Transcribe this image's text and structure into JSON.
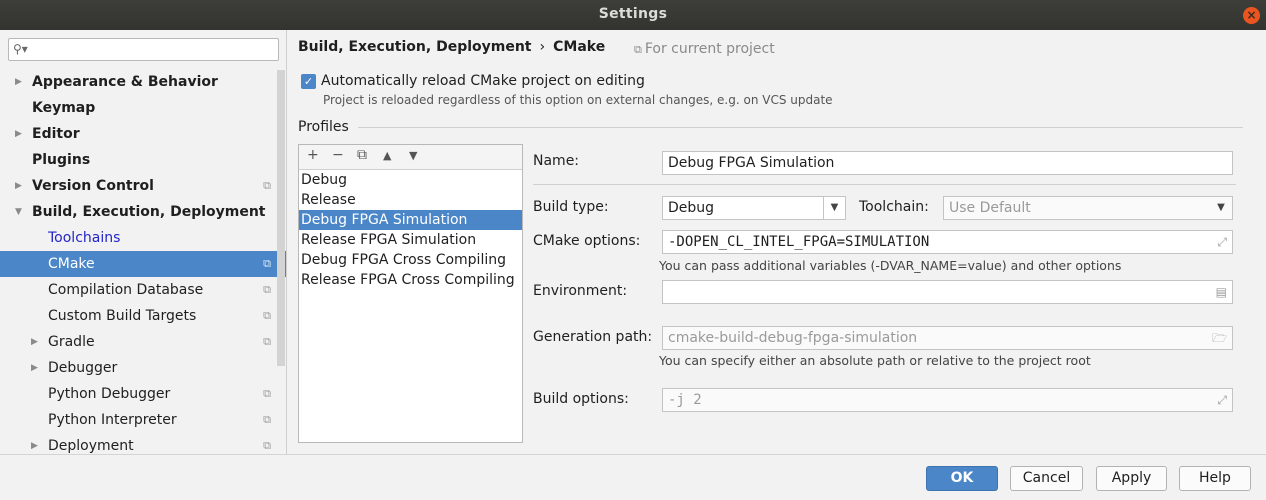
{
  "window": {
    "title": "Settings",
    "close_glyph": "×"
  },
  "sidebar": {
    "search_placeholder": "",
    "search_icon": "magnifier-icon",
    "items": [
      {
        "label": "Appearance & Behavior",
        "level": 0,
        "expandable": true,
        "expanded": false,
        "project_scoped": false
      },
      {
        "label": "Keymap",
        "level": 0,
        "expandable": false,
        "project_scoped": false
      },
      {
        "label": "Editor",
        "level": 0,
        "expandable": true,
        "expanded": false,
        "project_scoped": false
      },
      {
        "label": "Plugins",
        "level": 0,
        "expandable": false,
        "project_scoped": false
      },
      {
        "label": "Version Control",
        "level": 0,
        "expandable": true,
        "expanded": false,
        "project_scoped": true
      },
      {
        "label": "Build, Execution, Deployment",
        "level": 0,
        "expandable": true,
        "expanded": true,
        "project_scoped": false
      },
      {
        "label": "Toolchains",
        "level": 1,
        "expandable": false,
        "project_scoped": false,
        "link": true
      },
      {
        "label": "CMake",
        "level": 1,
        "expandable": false,
        "project_scoped": true,
        "selected": true
      },
      {
        "label": "Compilation Database",
        "level": 1,
        "expandable": false,
        "project_scoped": true
      },
      {
        "label": "Custom Build Targets",
        "level": 1,
        "expandable": false,
        "project_scoped": true
      },
      {
        "label": "Gradle",
        "level": 1,
        "expandable": true,
        "expanded": false,
        "project_scoped": true
      },
      {
        "label": "Debugger",
        "level": 1,
        "expandable": true,
        "expanded": false,
        "project_scoped": false
      },
      {
        "label": "Python Debugger",
        "level": 1,
        "expandable": false,
        "project_scoped": true
      },
      {
        "label": "Python Interpreter",
        "level": 1,
        "expandable": false,
        "project_scoped": true
      },
      {
        "label": "Deployment",
        "level": 1,
        "expandable": true,
        "expanded": false,
        "project_scoped": true
      }
    ]
  },
  "breadcrumb": {
    "parent": "Build, Execution, Deployment",
    "separator": "›",
    "current": "CMake"
  },
  "scope_label": "For current project",
  "auto_reload": {
    "checked": true,
    "label": "Automatically reload CMake project on editing",
    "hint": "Project is reloaded regardless of this option on external changes, e.g. on VCS update"
  },
  "profiles": {
    "title": "Profiles",
    "toolbar": [
      "+",
      "−",
      "⧉",
      "▲",
      "▼"
    ],
    "items": [
      "Debug",
      "Release",
      "Debug FPGA Simulation",
      "Release FPGA Simulation",
      "Debug FPGA Cross Compiling",
      "Release FPGA Cross Compiling"
    ],
    "selected": "Debug FPGA Simulation"
  },
  "form": {
    "name_label": "Name:",
    "name_value": "Debug FPGA Simulation",
    "build_type_label": "Build type:",
    "build_type_value": "Debug",
    "toolchain_label": "Toolchain:",
    "toolchain_value": "Use Default",
    "cmake_options_label": "CMake options:",
    "cmake_options_value": "-DOPEN_CL_INTEL_FPGA=SIMULATION",
    "cmake_options_hint": "You can pass additional variables (-DVAR_NAME=value) and other options",
    "environment_label": "Environment:",
    "environment_value": "",
    "generation_path_label": "Generation path:",
    "generation_path_value": "cmake-build-debug-fpga-simulation",
    "generation_path_hint": "You can specify either an absolute path or relative to the project root",
    "build_options_label": "Build options:",
    "build_options_value": "-j 2"
  },
  "buttons": {
    "ok": "OK",
    "cancel": "Cancel",
    "apply": "Apply",
    "help": "Help"
  },
  "colors": {
    "accent": "#4a86c8",
    "link": "#2424c8",
    "titlebar": "#3a3a37",
    "close": "#e9541f"
  }
}
